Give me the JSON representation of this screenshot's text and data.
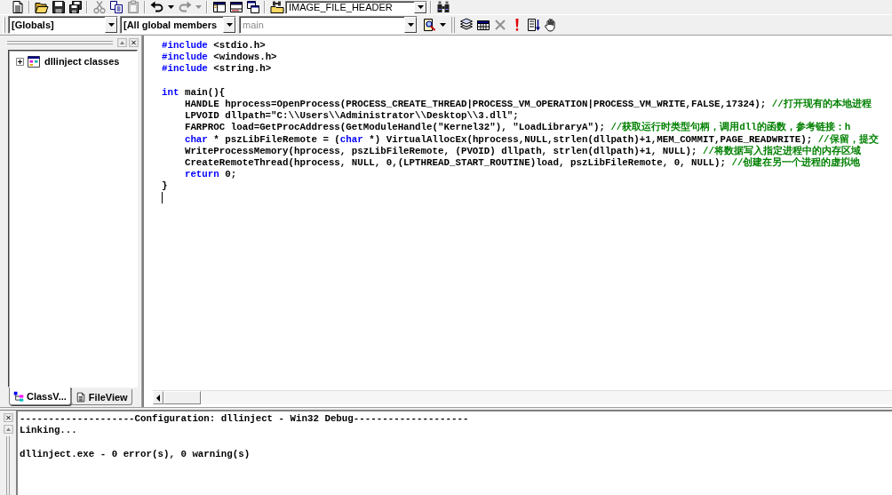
{
  "standard_toolbar": {
    "items": [
      {
        "kind": "button",
        "disabled": false
      },
      {
        "kind": "separator"
      },
      {
        "kind": "button",
        "disabled": false
      },
      {
        "kind": "button",
        "disabled": false
      },
      {
        "kind": "button",
        "disabled": false
      },
      {
        "kind": "separator"
      },
      {
        "kind": "button",
        "disabled": true
      },
      {
        "kind": "button",
        "disabled": false
      },
      {
        "kind": "button",
        "disabled": true
      },
      {
        "kind": "separator"
      },
      {
        "kind": "menu_button",
        "disabled": false
      },
      {
        "kind": "menu_button",
        "disabled": true
      },
      {
        "kind": "separator"
      },
      {
        "kind": "button",
        "disabled": false
      },
      {
        "kind": "button",
        "disabled": false
      },
      {
        "kind": "button",
        "disabled": false
      },
      {
        "kind": "separator"
      },
      {
        "kind": "button",
        "disabled": false
      },
      {
        "kind": "combo",
        "value": "IMAGE_FILE_HEADER"
      },
      {
        "kind": "separator"
      },
      {
        "kind": "button",
        "disabled": false
      }
    ]
  },
  "wizard_bar": {
    "combos": [
      {
        "value": "[Globals]",
        "disabled": false
      },
      {
        "value": "[All global members",
        "disabled": false
      },
      {
        "value": "main",
        "disabled": true
      }
    ]
  },
  "build_toolbar": {
    "buttons": [
      {
        "disabled": false
      },
      {
        "disabled": false
      },
      {
        "disabled": true
      },
      {
        "disabled": false
      },
      {
        "disabled": false
      },
      {
        "disabled": false
      }
    ]
  },
  "workspace": {
    "tree": [
      {
        "label": "dllinject classes",
        "expanded": false
      }
    ],
    "tabs": [
      {
        "label": "ClassV...",
        "selected": true
      },
      {
        "label": "FileView",
        "selected": false
      }
    ]
  },
  "editor": {
    "blocks": [
      {
        "lines": [
          {
            "tokens": [
              {
                "kind": "keyword",
                "text": "#include"
              },
              {
                "kind": "plain",
                "text": " <stdio.h>"
              }
            ]
          },
          {
            "tokens": [
              {
                "kind": "keyword",
                "text": "#include"
              },
              {
                "kind": "plain",
                "text": " <windows.h>"
              }
            ]
          },
          {
            "tokens": [
              {
                "kind": "keyword",
                "text": "#include"
              },
              {
                "kind": "plain",
                "text": " <string.h>"
              }
            ]
          }
        ]
      },
      {
        "lines": [
          {
            "tokens": [
              {
                "kind": "keyword",
                "text": "int"
              },
              {
                "kind": "plain",
                "text": " main(){"
              }
            ],
            "children": [
              {
                "tokens": [
                  {
                    "kind": "plain",
                    "text": "HANDLE hprocess=OpenProcess(PROCESS_CREATE_THREAD|PROCESS_VM_OPERATION|PROCESS_VM_WRITE,FALSE,17324); "
                  },
                  {
                    "kind": "comment",
                    "text": "//打开现有的本地进程"
                  }
                ]
              },
              {
                "tokens": [
                  {
                    "kind": "plain",
                    "text": "LPVOID dllpath=\"C:\\\\Users\\\\Administrator\\\\Desktop\\\\3.dll\";"
                  }
                ]
              },
              {
                "tokens": [
                  {
                    "kind": "plain",
                    "text": "FARPROC load=GetProcAddress(GetModuleHandle(\"Kernel32\"), \"LoadLibraryA\"); "
                  },
                  {
                    "kind": "comment",
                    "text": "//获取运行时类型句柄，调用dll的函数，参考链接：h"
                  }
                ]
              },
              {
                "tokens": [
                  {
                    "kind": "keyword",
                    "text": "char"
                  },
                  {
                    "kind": "plain",
                    "text": " * pszLibFileRemote = ("
                  },
                  {
                    "kind": "keyword",
                    "text": "char"
                  },
                  {
                    "kind": "plain",
                    "text": " *) VirtualAllocEx(hprocess,NULL,strlen(dllpath)+1,MEM_COMMIT,PAGE_READWRITE); "
                  },
                  {
                    "kind": "comment",
                    "text": "//保留，提交"
                  }
                ]
              },
              {
                "tokens": [
                  {
                    "kind": "plain",
                    "text": "WriteProcessMemory(hprocess, pszLibFileRemote, (PVOID) dllpath, strlen(dllpath)+1, NULL); "
                  },
                  {
                    "kind": "comment",
                    "text": "//将数据写入指定进程中的内存区域"
                  }
                ]
              },
              {
                "tokens": [
                  {
                    "kind": "plain",
                    "text": "CreateRemoteThread(hprocess, NULL, 0,(LPTHREAD_START_ROUTINE)load, pszLibFileRemote, 0, NULL); "
                  },
                  {
                    "kind": "comment",
                    "text": "//创建在另一个进程的虚拟地"
                  }
                ]
              },
              {
                "tokens": [
                  {
                    "kind": "keyword",
                    "text": "return"
                  },
                  {
                    "kind": "plain",
                    "text": " 0;"
                  }
                ]
              }
            ]
          },
          {
            "tokens": [
              {
                "kind": "plain",
                "text": "}"
              }
            ]
          }
        ]
      }
    ]
  },
  "output": {
    "blocks": [
      {
        "lines": [
          "--------------------Configuration: dllinject - Win32 Debug--------------------",
          "Linking..."
        ]
      },
      {
        "lines": [
          "dllinject.exe - 0 error(s), 0 warning(s)"
        ]
      }
    ]
  }
}
